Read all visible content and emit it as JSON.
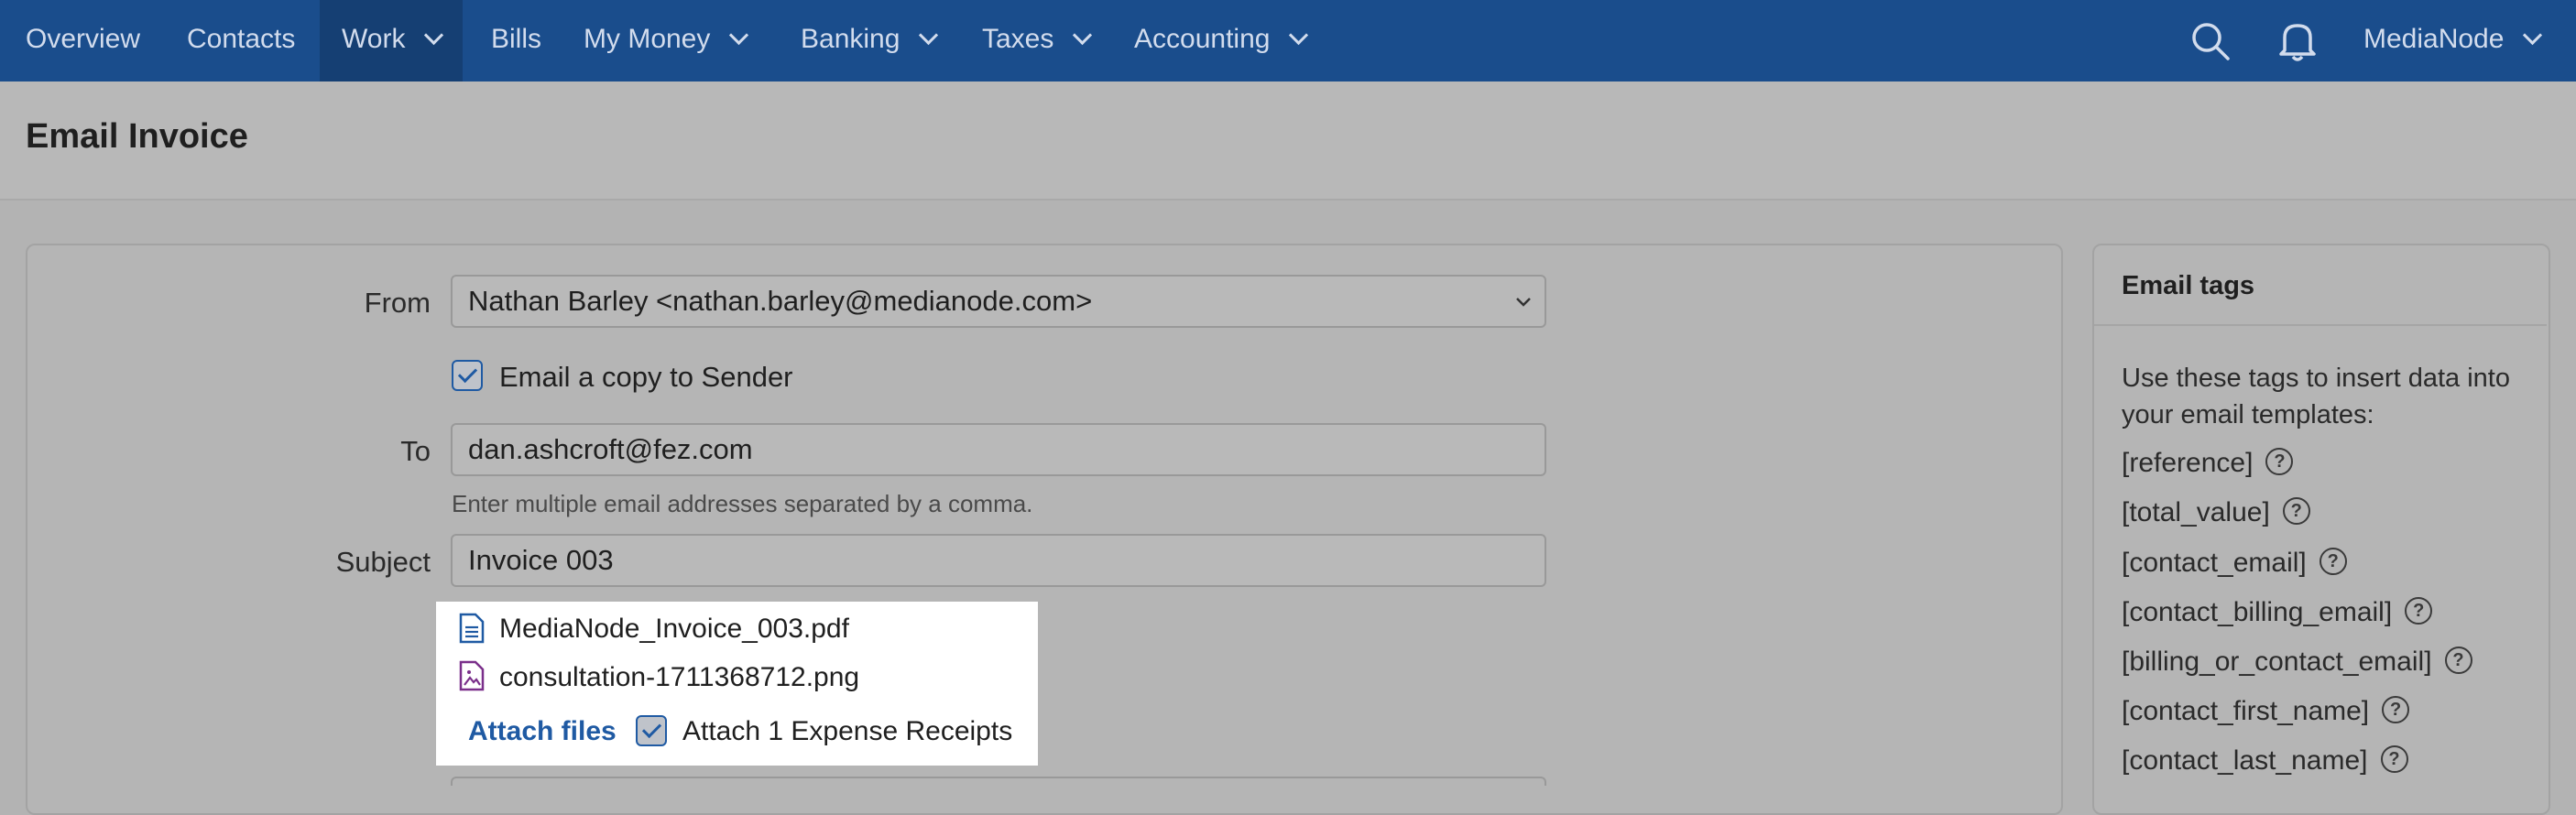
{
  "nav": {
    "items": [
      {
        "label": "Overview",
        "dropdown": false,
        "active": false
      },
      {
        "label": "Contacts",
        "dropdown": false,
        "active": false
      },
      {
        "label": "Work",
        "dropdown": true,
        "active": true
      },
      {
        "label": "Bills",
        "dropdown": false,
        "active": false
      },
      {
        "label": "My Money",
        "dropdown": true,
        "active": false
      },
      {
        "label": "Banking",
        "dropdown": true,
        "active": false
      },
      {
        "label": "Taxes",
        "dropdown": true,
        "active": false
      },
      {
        "label": "Accounting",
        "dropdown": true,
        "active": false
      }
    ],
    "account_label": "MediaNode",
    "icons": [
      "search-icon",
      "bell-icon"
    ]
  },
  "page": {
    "title": "Email Invoice"
  },
  "form": {
    "from_label": "From",
    "from_value": "Nathan Barley <nathan.barley@medianode.com>",
    "copy_sender_label": "Email a copy to Sender",
    "copy_sender_checked": true,
    "to_label": "To",
    "to_value": "dan.ashcroft@fez.com",
    "to_help": "Enter multiple email addresses separated by a comma.",
    "subject_label": "Subject",
    "subject_value": "Invoice 003"
  },
  "attachments": {
    "files": [
      {
        "name": "MediaNode_Invoice_003.pdf",
        "icon": "document-icon"
      },
      {
        "name": "consultation-1711368712.png",
        "icon": "image-file-icon"
      }
    ],
    "attach_files_label": "Attach files",
    "expense_receipts_label": "Attach 1 Expense Receipts",
    "expense_receipts_checked": true
  },
  "email_tags": {
    "title": "Email tags",
    "intro": "Use these tags to insert data into your email templates:",
    "tags": [
      "[reference]",
      "[total_value]",
      "[contact_email]",
      "[contact_billing_email]",
      "[billing_or_contact_email]",
      "[contact_first_name]",
      "[contact_last_name]"
    ]
  },
  "colors": {
    "nav_bg": "#1a4d8c",
    "link": "#1f5aa3",
    "overlay_gray": "#b3b3b3"
  }
}
